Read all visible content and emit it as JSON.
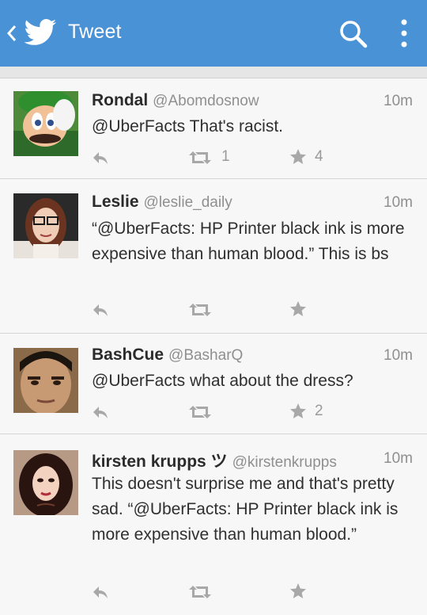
{
  "header": {
    "title": "Tweet",
    "back_icon": "chevron-left-icon",
    "logo_icon": "twitter-bird-icon",
    "search_icon": "search-icon",
    "menu_icon": "more-vertical-icon",
    "bg_color": "#4a92d6"
  },
  "tweets": [
    {
      "name": "Rondal",
      "handle": "@Abomdosnow",
      "time": "10m",
      "text": "@UberFacts That's racist.",
      "retweets": "1",
      "favorites": "4"
    },
    {
      "name": "Leslie",
      "handle": "@leslie_daily",
      "time": "10m",
      "text": "“@UberFacts: HP Printer black ink is more expensive than human blood.” This is bs",
      "retweets": "",
      "favorites": ""
    },
    {
      "name": "BashCue",
      "handle": "@BasharQ",
      "time": "10m",
      "text": "@UberFacts what about the dress?",
      "retweets": "",
      "favorites": "2"
    },
    {
      "name": "kirsten krupps ツ",
      "handle": "@kirstenkrupps",
      "time": "10m",
      "text": "This doesn't surprise me and that's pretty sad. “@UberFacts: HP Printer black ink is more expensive than human blood.”",
      "retweets": "",
      "favorites": ""
    }
  ]
}
